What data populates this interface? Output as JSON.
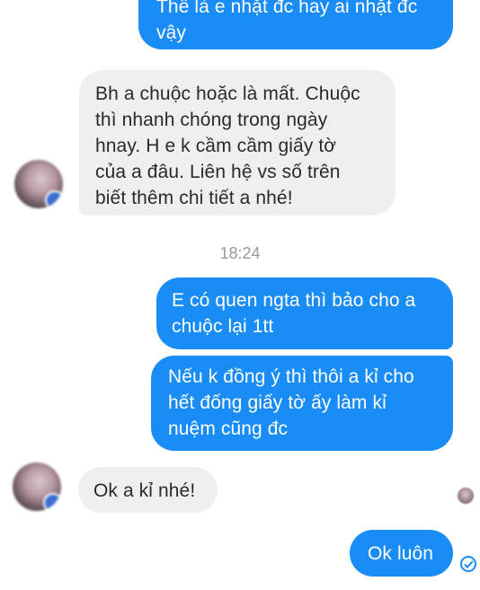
{
  "messages": [
    {
      "direction": "outgoing",
      "text": "Thế là e nhặt đc hay ai nhặt đc\nvậy"
    },
    {
      "direction": "incoming",
      "text": "Bh a chuộc hoặc là mất. Chuộc\nthì nhanh chóng trong ngày\nhnay. H e k cầm cầm giấy tờ\ncủa a đâu. Liên hệ vs số trên\nbiết thêm chi tiết a nhé!"
    },
    {
      "direction": "outgoing",
      "text": "E có quen ngta thì bảo cho a\nchuộc lại 1tt"
    },
    {
      "direction": "outgoing",
      "text": "Nếu k đồng ý thì thôi a kỉ cho\nhết đống giấy tờ ấy làm kỉ\nnuệm cũng đc"
    },
    {
      "direction": "incoming",
      "text": "Ok a kỉ nhé!"
    },
    {
      "direction": "outgoing",
      "text": "Ok luôn"
    }
  ],
  "timestamp": "18:24",
  "colors": {
    "outgoing_bubble": "#1a8cf5",
    "incoming_bubble": "#efeff1",
    "timestamp_text": "#9a9a9a"
  },
  "icons": {
    "contact_avatar": "blurred-avatar-icon",
    "seen_indicator": "seen-avatar-icon",
    "sent_status": "check-circle-icon"
  }
}
